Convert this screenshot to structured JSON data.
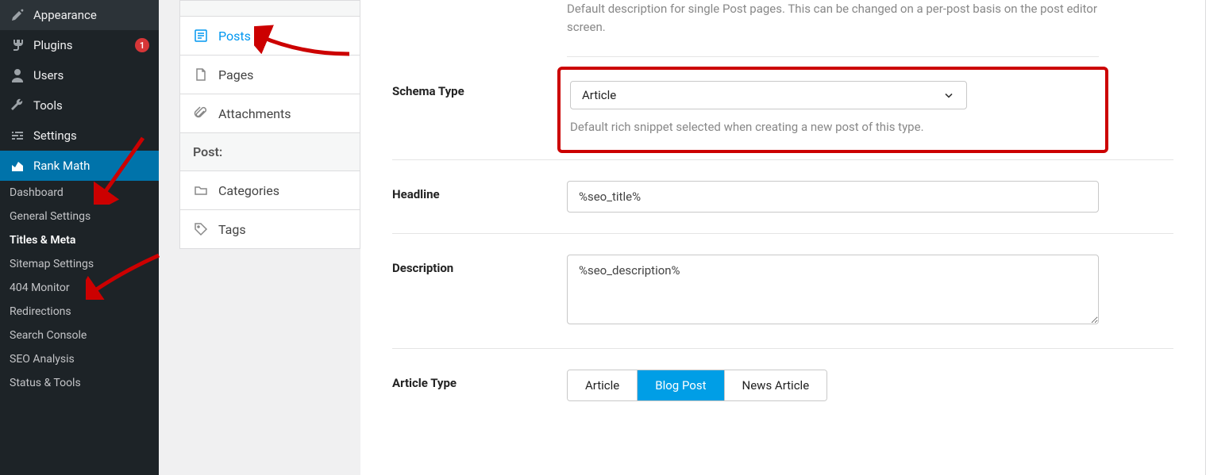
{
  "wp_menu": {
    "appearance": "Appearance",
    "plugins": "Plugins",
    "plugins_badge": "1",
    "users": "Users",
    "tools": "Tools",
    "settings": "Settings",
    "rank_math": "Rank Math",
    "sub": {
      "dashboard": "Dashboard",
      "general_settings": "General Settings",
      "titles_meta": "Titles & Meta",
      "sitemap_settings": "Sitemap Settings",
      "monitor_404": "404 Monitor",
      "redirections": "Redirections",
      "search_console": "Search Console",
      "seo_analysis": "SEO Analysis",
      "status_tools": "Status & Tools"
    }
  },
  "tabs": {
    "posts": "Posts",
    "pages": "Pages",
    "attachments": "Attachments",
    "heading": "Post:",
    "categories": "Categories",
    "tags_": "Tags"
  },
  "content": {
    "intro_help": "Default description for single Post pages. This can be changed on a per-post basis on the post editor screen.",
    "schema_type": {
      "label": "Schema Type",
      "value": "Article",
      "help": "Default rich snippet selected when creating a new post of this type."
    },
    "headline": {
      "label": "Headline",
      "value": "%seo_title%"
    },
    "description": {
      "label": "Description",
      "value": "%seo_description%"
    },
    "article_type": {
      "label": "Article Type",
      "options": [
        "Article",
        "Blog Post",
        "News Article"
      ],
      "selected": "Blog Post"
    }
  },
  "colors": {
    "accent": "#0073aa",
    "highlight": "#cc0000",
    "seg_on": "#009ee6"
  }
}
